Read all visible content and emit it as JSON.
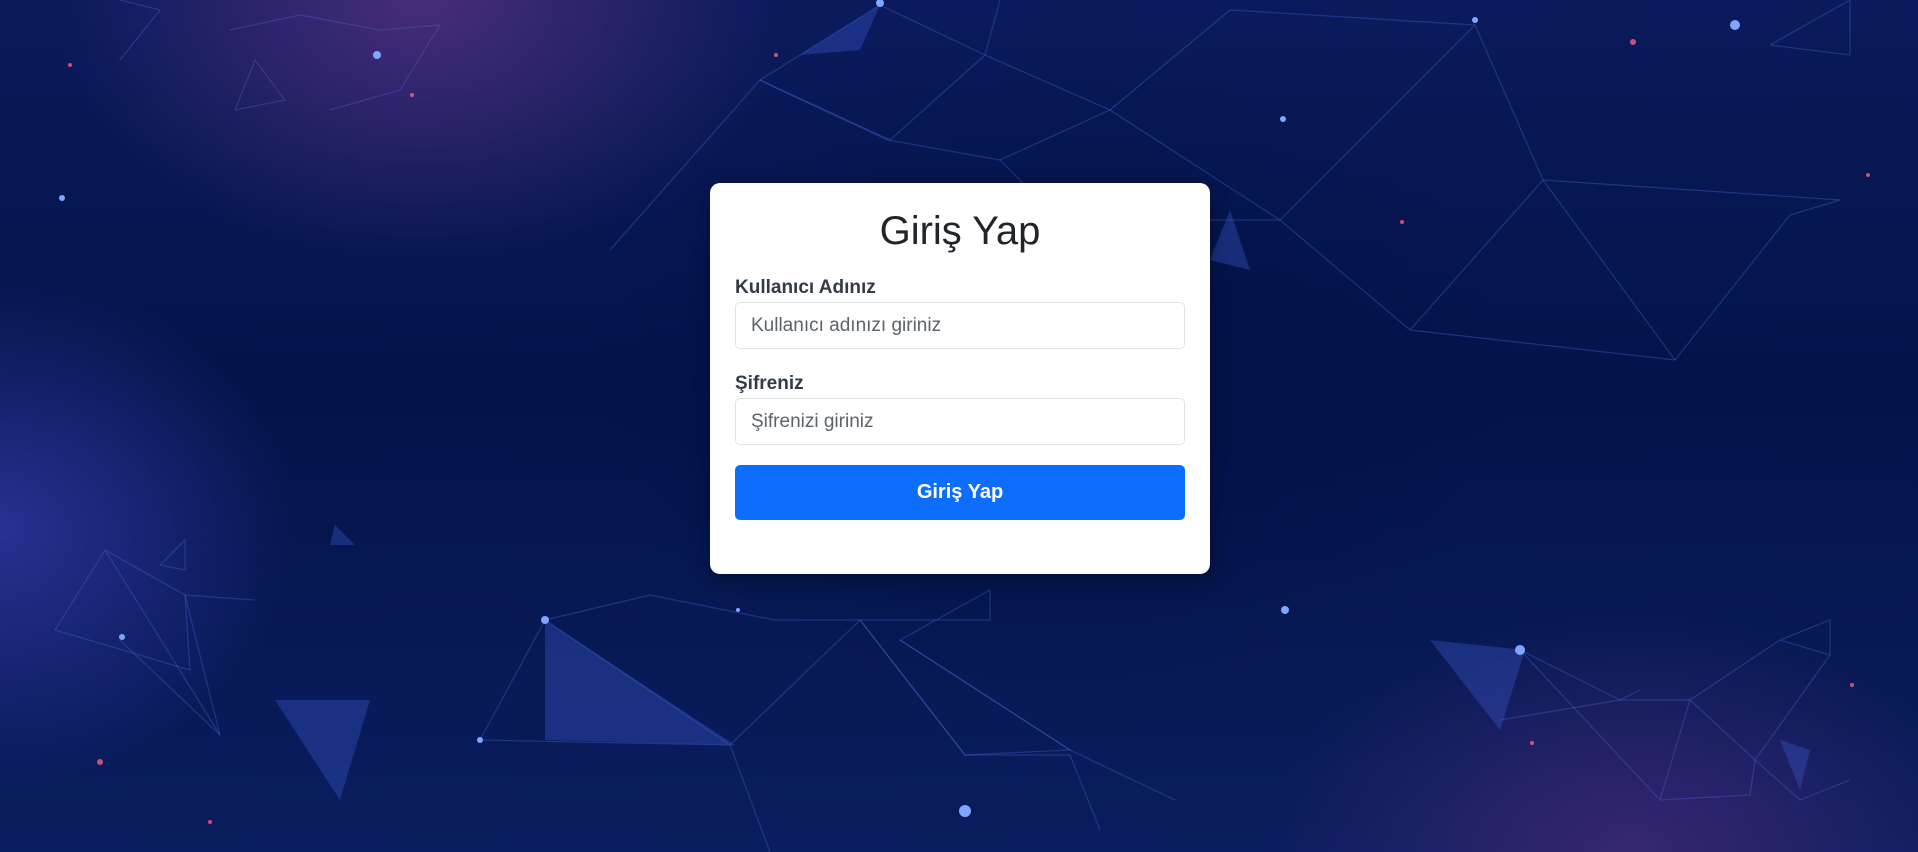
{
  "login": {
    "title": "Giriş Yap",
    "username_label": "Kullanıcı Adınız",
    "username_placeholder": "Kullanıcı adınızı giriniz",
    "password_label": "Şifreniz",
    "password_placeholder": "Şifrenizi giriniz",
    "submit_label": "Giriş Yap"
  },
  "colors": {
    "background": "#04144a",
    "card": "#ffffff",
    "button": "#0d6efd",
    "button_text": "#ffffff",
    "label": "#333b47"
  }
}
